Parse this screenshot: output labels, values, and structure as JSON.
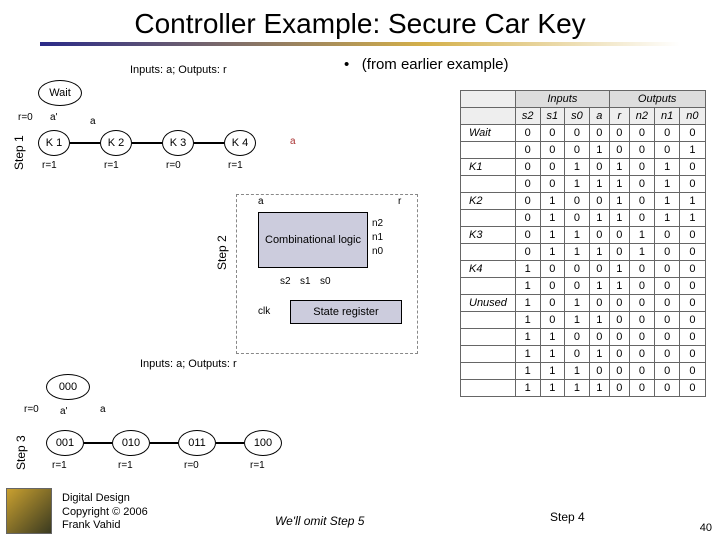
{
  "title": "Controller Example: Secure Car Key",
  "subtitle_bullet": "•",
  "subtitle": "(from earlier example)",
  "io_caption": "Inputs: a; Outputs: r",
  "steps": {
    "s1": "Step 1",
    "s2": "Step 2",
    "s3": "Step 3"
  },
  "fsm1": {
    "wait": "Wait",
    "self_cond": "a'",
    "trans": "a",
    "r0": "r=0",
    "states": [
      "K 1",
      "K 2",
      "K 3",
      "K 4"
    ],
    "outs": [
      "r=1",
      "r=1",
      "r=0",
      "r=1"
    ]
  },
  "fsm3": {
    "wait_code": "000",
    "self_cond": "a'",
    "trans": "a",
    "r0": "r=0",
    "states": [
      "001",
      "010",
      "011",
      "100"
    ],
    "outs": [
      "r=1",
      "r=1",
      "r=0",
      "r=1"
    ]
  },
  "block": {
    "comb": "Combinational logic",
    "reg": "State register",
    "a": "a",
    "r": "r",
    "n2": "n2",
    "n1": "n1",
    "n0": "n0",
    "s2": "s2",
    "s1": "s1",
    "s0": "s0",
    "clk": "clk"
  },
  "table": {
    "group_in": "Inputs",
    "group_out": "Outputs",
    "cols_in": [
      "s2",
      "s1",
      "s0",
      "a"
    ],
    "cols_out": [
      "r",
      "n2",
      "n1",
      "n0"
    ],
    "rows": [
      {
        "name": "Wait",
        "in": [
          "0",
          "0",
          "0",
          "0"
        ],
        "out": [
          "0",
          "0",
          "0",
          "0"
        ]
      },
      {
        "name": "",
        "in": [
          "0",
          "0",
          "0",
          "1"
        ],
        "out": [
          "0",
          "0",
          "0",
          "1"
        ]
      },
      {
        "name": "K1",
        "in": [
          "0",
          "0",
          "1",
          "0"
        ],
        "out": [
          "1",
          "0",
          "1",
          "0"
        ]
      },
      {
        "name": "",
        "in": [
          "0",
          "0",
          "1",
          "1"
        ],
        "out": [
          "1",
          "0",
          "1",
          "0"
        ]
      },
      {
        "name": "K2",
        "in": [
          "0",
          "1",
          "0",
          "0"
        ],
        "out": [
          "1",
          "0",
          "1",
          "1"
        ]
      },
      {
        "name": "",
        "in": [
          "0",
          "1",
          "0",
          "1"
        ],
        "out": [
          "1",
          "0",
          "1",
          "1"
        ]
      },
      {
        "name": "K3",
        "in": [
          "0",
          "1",
          "1",
          "0"
        ],
        "out": [
          "0",
          "1",
          "0",
          "0"
        ]
      },
      {
        "name": "",
        "in": [
          "0",
          "1",
          "1",
          "1"
        ],
        "out": [
          "0",
          "1",
          "0",
          "0"
        ]
      },
      {
        "name": "K4",
        "in": [
          "1",
          "0",
          "0",
          "0"
        ],
        "out": [
          "1",
          "0",
          "0",
          "0"
        ]
      },
      {
        "name": "",
        "in": [
          "1",
          "0",
          "0",
          "1"
        ],
        "out": [
          "1",
          "0",
          "0",
          "0"
        ]
      },
      {
        "name": "Unused",
        "in": [
          "1",
          "0",
          "1",
          "0"
        ],
        "out": [
          "0",
          "0",
          "0",
          "0"
        ]
      },
      {
        "name": "",
        "in": [
          "1",
          "0",
          "1",
          "1"
        ],
        "out": [
          "0",
          "0",
          "0",
          "0"
        ]
      },
      {
        "name": "",
        "in": [
          "1",
          "1",
          "0",
          "0"
        ],
        "out": [
          "0",
          "0",
          "0",
          "0"
        ]
      },
      {
        "name": "",
        "in": [
          "1",
          "1",
          "0",
          "1"
        ],
        "out": [
          "0",
          "0",
          "0",
          "0"
        ]
      },
      {
        "name": "",
        "in": [
          "1",
          "1",
          "1",
          "0"
        ],
        "out": [
          "0",
          "0",
          "0",
          "0"
        ]
      },
      {
        "name": "",
        "in": [
          "1",
          "1",
          "1",
          "1"
        ],
        "out": [
          "0",
          "0",
          "0",
          "0"
        ]
      }
    ]
  },
  "step5": "We'll omit Step 5",
  "step4": "Step 4",
  "footer": {
    "l1": "Digital Design",
    "l2": "Copyright © 2006",
    "l3": "Frank Vahid"
  },
  "page": "40"
}
